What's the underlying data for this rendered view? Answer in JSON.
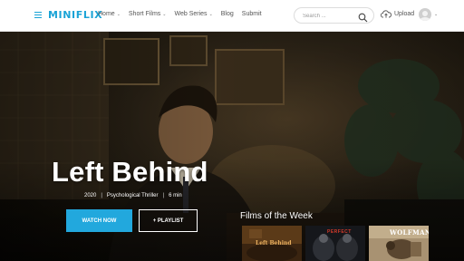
{
  "header": {
    "logo": "MINIFLIX",
    "nav": [
      {
        "label": "Home",
        "has_dropdown": true
      },
      {
        "label": "Short Films",
        "has_dropdown": true
      },
      {
        "label": "Web Series",
        "has_dropdown": true
      },
      {
        "label": "Blog",
        "has_dropdown": false
      },
      {
        "label": "Submit",
        "has_dropdown": false
      }
    ],
    "search_placeholder": "Search ...",
    "upload_label": "Upload",
    "icons": [
      "menu-icon",
      "search-icon",
      "upload-cloud-icon",
      "user-avatar-icon",
      "chevron-down-icon"
    ]
  },
  "hero": {
    "title": "Left Behind",
    "meta": {
      "year": "2020",
      "genre": "Psychological Thriller",
      "duration": "6 min"
    },
    "watch_button": "WATCH NOW",
    "playlist_button": "+ PLAYLIST"
  },
  "films_of_week": {
    "heading": "Films of the Week",
    "items": [
      {
        "label": "Left Behind"
      },
      {
        "label": "PERFECT"
      },
      {
        "label": "WOLFMAN"
      }
    ]
  },
  "colors": {
    "accent": "#1aa3d6",
    "watch_button": "#22a8dd",
    "header_bg": "#ffffff",
    "hero_text": "#ffffff"
  }
}
